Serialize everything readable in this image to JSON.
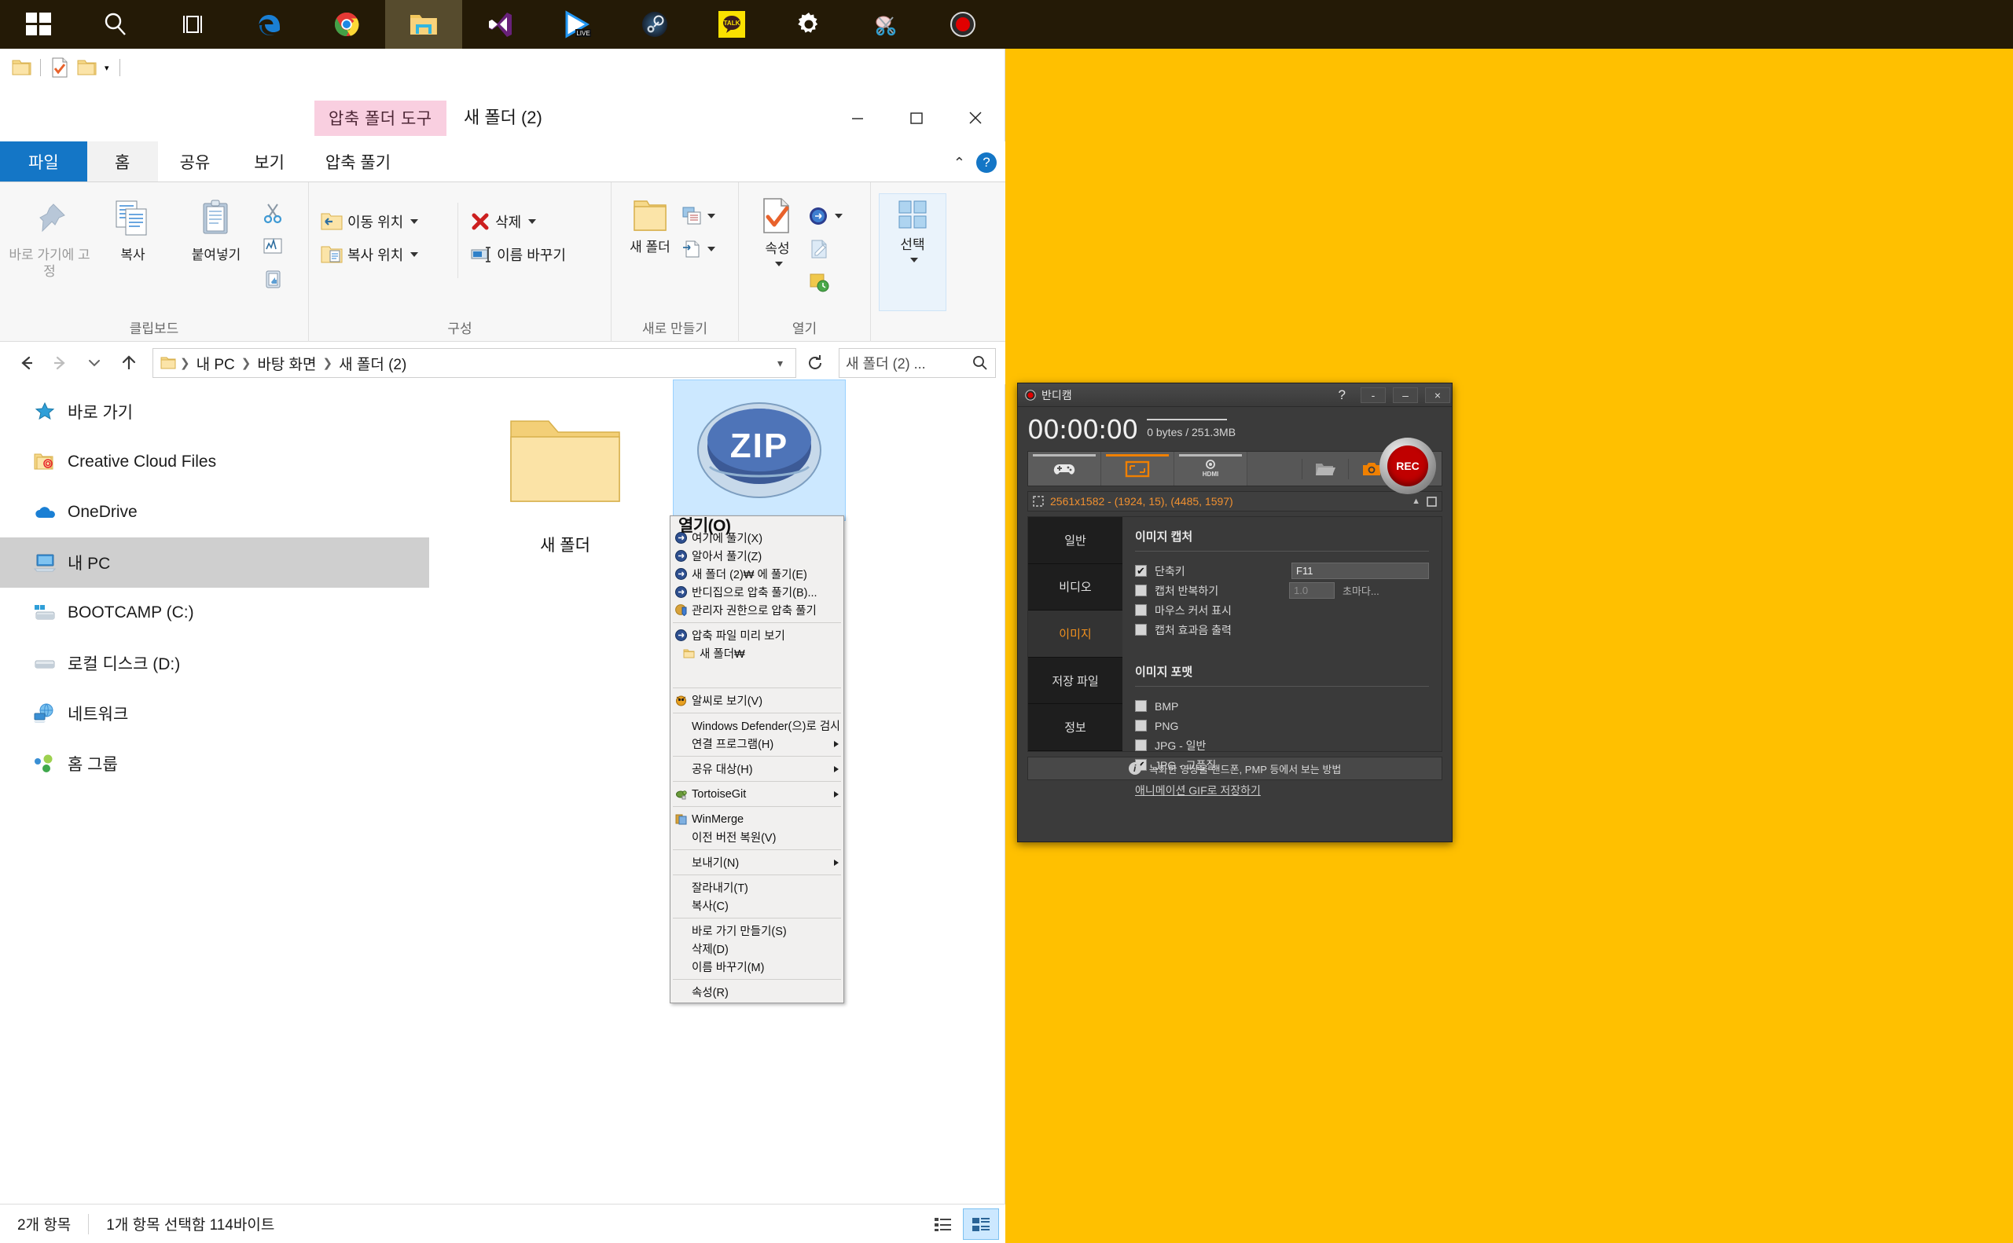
{
  "taskbar": {
    "items": [
      {
        "name": "start-button",
        "icon": "windows-logo-icon"
      },
      {
        "name": "search-button",
        "icon": "search-icon"
      },
      {
        "name": "task-view-button",
        "icon": "task-view-icon"
      },
      {
        "name": "edge-button",
        "icon": "edge-icon"
      },
      {
        "name": "chrome-button",
        "icon": "chrome-icon"
      },
      {
        "name": "file-explorer-button",
        "icon": "folder-icon"
      },
      {
        "name": "visual-studio-button",
        "icon": "visual-studio-icon"
      },
      {
        "name": "live-player-button",
        "icon": "live-play-icon"
      },
      {
        "name": "steam-button",
        "icon": "steam-icon"
      },
      {
        "name": "kakaotalk-button",
        "icon": "talk-icon",
        "label": "TALK"
      },
      {
        "name": "settings-button",
        "icon": "gear-icon"
      },
      {
        "name": "snipping-tool-button",
        "icon": "scissors-icon"
      },
      {
        "name": "bandicam-button",
        "icon": "record-icon"
      }
    ]
  },
  "explorer": {
    "title": "새 폴더 (2)",
    "context_tab_group": "압축 폴더 도구",
    "context_tab": "압축 풀기",
    "quick_access": {
      "folder_icon": "folder-icon",
      "properties_icon": "properties-icon",
      "new_folder_icon": "new-folder-icon",
      "dropdown_icon": "chevron-down-icon"
    },
    "window_controls": {
      "minimize": "minimize-icon",
      "maximize": "maximize-icon",
      "close": "close-icon"
    },
    "tabs": [
      {
        "label": "파일",
        "state": "file"
      },
      {
        "label": "홈",
        "state": "selected"
      },
      {
        "label": "공유",
        "state": "normal"
      },
      {
        "label": "보기",
        "state": "normal"
      }
    ],
    "help_label": "?",
    "ribbon": {
      "groups": [
        {
          "label": "클립보드",
          "big": [
            {
              "label": "바로 가기에 고정",
              "icon": "pin-icon",
              "dim": true
            },
            {
              "label": "복사",
              "icon": "copy-icon",
              "dim": false
            },
            {
              "label": "붙여넣기",
              "icon": "paste-icon",
              "dim": false
            }
          ],
          "minis": [
            {
              "icon": "scissors-icon"
            },
            {
              "icon": "copy-path-icon"
            },
            {
              "icon": "paste-shortcut-icon"
            }
          ]
        },
        {
          "label": "구성",
          "small": [
            {
              "label": "이동 위치",
              "icon": "move-to-icon",
              "caret": true
            },
            {
              "label": "복사 위치",
              "icon": "copy-to-icon",
              "caret": true
            }
          ],
          "small2": [
            {
              "label": "삭제",
              "icon": "delete-x-icon",
              "caret": true
            },
            {
              "label": "이름 바꾸기",
              "icon": "rename-icon",
              "caret": false
            }
          ]
        },
        {
          "label": "새로 만들기",
          "big": [
            {
              "label": "새 폴더",
              "icon": "new-folder-icon"
            }
          ],
          "minis": [
            {
              "icon": "new-item-icon"
            },
            {
              "icon": "easy-access-icon"
            }
          ]
        },
        {
          "label": "열기",
          "big": [
            {
              "label": "속성",
              "icon": "properties-icon",
              "caret": true
            }
          ],
          "minis": [
            {
              "icon": "open-with-icon"
            },
            {
              "icon": "edit-icon"
            },
            {
              "icon": "history-icon"
            }
          ]
        },
        {
          "label": "",
          "big": [
            {
              "label": "선택",
              "icon": "select-grid-icon",
              "caret": true,
              "boxed": true
            }
          ]
        }
      ]
    },
    "address": {
      "back_icon": "arrow-left-icon",
      "forward_icon": "arrow-right-icon",
      "recent_icon": "chevron-down-icon",
      "up_icon": "arrow-up-icon",
      "folder_icon": "folder-icon",
      "crumbs": [
        "내 PC",
        "바탕 화면",
        "새 폴더 (2)"
      ],
      "dropdown_icon": "chevron-down-icon",
      "refresh_icon": "refresh-icon",
      "search_placeholder": "새 폴더 (2) ...",
      "search_icon": "search-icon"
    },
    "nav_items": [
      {
        "label": "바로 가기",
        "icon": "star-icon",
        "selected": false
      },
      {
        "label": "Creative Cloud Files",
        "icon": "creative-cloud-icon",
        "selected": false
      },
      {
        "label": "OneDrive",
        "icon": "cloud-icon",
        "selected": false
      },
      {
        "label": "내 PC",
        "icon": "this-pc-icon",
        "selected": true
      },
      {
        "label": "BOOTCAMP (C:)",
        "icon": "drive-windows-icon",
        "selected": false
      },
      {
        "label": "로컬 디스크 (D:)",
        "icon": "drive-icon",
        "selected": false
      },
      {
        "label": "네트워크",
        "icon": "network-icon",
        "selected": false
      },
      {
        "label": "홈 그룹",
        "icon": "homegroup-icon",
        "selected": false
      }
    ],
    "files": [
      {
        "name": "새 폴더",
        "icon": "folder-icon",
        "selected": false
      },
      {
        "name": "",
        "icon": "zip-archive-icon",
        "selected": true
      }
    ],
    "status": {
      "count": "2개 항목",
      "selection": "1개 항목 선택함 114바이트",
      "view_detail_icon": "details-view-icon",
      "view_large_icon": "large-icons-view-icon"
    }
  },
  "context_menu": {
    "header": "열기(O)",
    "items": [
      {
        "label": "여기에 풀기(X)",
        "icon": "alzip-icon",
        "type": "item"
      },
      {
        "label": "알아서 풀기(Z)",
        "icon": "alzip-icon",
        "type": "item"
      },
      {
        "label": "새 폴더 (2)₩ 에 풀기(E)",
        "icon": "alzip-icon",
        "type": "item"
      },
      {
        "label": "반디집으로 압축 풀기(B)...",
        "icon": "alzip-icon",
        "type": "item"
      },
      {
        "label": "관리자 권한으로 압축 풀기",
        "icon": "shield-zip-icon",
        "type": "item"
      },
      {
        "type": "sep"
      },
      {
        "label": "압축 파일 미리 보기",
        "icon": "alzip-icon",
        "type": "item"
      },
      {
        "label": "새 폴더₩",
        "icon": "folder-icon",
        "type": "item"
      },
      {
        "type": "gap"
      },
      {
        "type": "sep"
      },
      {
        "label": "알씨로 보기(V)",
        "icon": "alsee-icon",
        "type": "item"
      },
      {
        "type": "sep"
      },
      {
        "label": "Windows Defender(으)로 검사...",
        "icon": "",
        "type": "item"
      },
      {
        "label": "연결 프로그램(H)",
        "icon": "",
        "type": "item",
        "submenu": true
      },
      {
        "type": "sep"
      },
      {
        "label": "공유 대상(H)",
        "icon": "",
        "type": "item",
        "submenu": true
      },
      {
        "type": "sep"
      },
      {
        "label": "TortoiseGit",
        "icon": "tortoise-icon",
        "type": "item",
        "submenu": true
      },
      {
        "type": "sep"
      },
      {
        "label": "WinMerge",
        "icon": "winmerge-icon",
        "type": "item"
      },
      {
        "label": "이전 버전 복원(V)",
        "icon": "",
        "type": "item"
      },
      {
        "type": "sep"
      },
      {
        "label": "보내기(N)",
        "icon": "",
        "type": "item",
        "submenu": true
      },
      {
        "type": "sep"
      },
      {
        "label": "잘라내기(T)",
        "icon": "",
        "type": "item"
      },
      {
        "label": "복사(C)",
        "icon": "",
        "type": "item"
      },
      {
        "type": "sep"
      },
      {
        "label": "바로 가기 만들기(S)",
        "icon": "",
        "type": "item"
      },
      {
        "label": "삭제(D)",
        "icon": "",
        "type": "item"
      },
      {
        "label": "이름 바꾸기(M)",
        "icon": "",
        "type": "item"
      },
      {
        "type": "sep"
      },
      {
        "label": "속성(R)",
        "icon": "",
        "type": "item"
      }
    ]
  },
  "bandicam": {
    "title": "반디캠",
    "help": "?",
    "win_buttons": [
      "-",
      "–",
      "×"
    ],
    "time": "00:00:00",
    "size": "0 bytes / 251.3MB",
    "toolbar": [
      {
        "name": "game-recording-mode",
        "icon": "gamepad-icon",
        "active": false
      },
      {
        "name": "screen-recording-mode",
        "icon": "screen-rect-icon",
        "active": true
      },
      {
        "name": "device-recording-mode",
        "icon": "hdmi-device-icon",
        "active": false
      },
      {
        "name": "open-output-folder",
        "icon": "folder-open-icon",
        "active": false
      },
      {
        "name": "capture-image",
        "icon": "camera-icon",
        "active": false
      },
      {
        "name": "pause-button",
        "icon": "pause-icon",
        "active": false
      }
    ],
    "rec_label": "REC",
    "resolution": "2561x1582 - (1924, 15), (4485, 1597)",
    "sidebar": [
      {
        "label": "일반",
        "active": false
      },
      {
        "label": "비디오",
        "active": false
      },
      {
        "label": "이미지",
        "active": true
      },
      {
        "label": "저장 파일",
        "active": false
      },
      {
        "label": "정보",
        "active": false
      }
    ],
    "image_capture": {
      "heading": "이미지 캡처",
      "rows": [
        {
          "label": "단축키",
          "checked": true,
          "value": "F11",
          "field": "wide"
        },
        {
          "label": "캡처 반복하기",
          "checked": false,
          "value": "1.0",
          "field": "narrow",
          "suffix": "초마다..."
        },
        {
          "label": "마우스 커서 표시",
          "checked": false
        },
        {
          "label": "캡처 효과음 출력",
          "checked": false
        }
      ]
    },
    "image_format": {
      "heading": "이미지 포맷",
      "options": [
        {
          "label": "BMP",
          "checked": false
        },
        {
          "label": "PNG",
          "checked": false
        },
        {
          "label": "JPG - 일반",
          "checked": false
        },
        {
          "label": "JPG - 고품질",
          "checked": true
        }
      ],
      "link": "애니메이션 GIF로 저장하기"
    },
    "footer": "녹화한 영상을 핸드폰, PMP 등에서 보는 방법"
  },
  "desktop": {
    "background_color": "#ffc000"
  }
}
